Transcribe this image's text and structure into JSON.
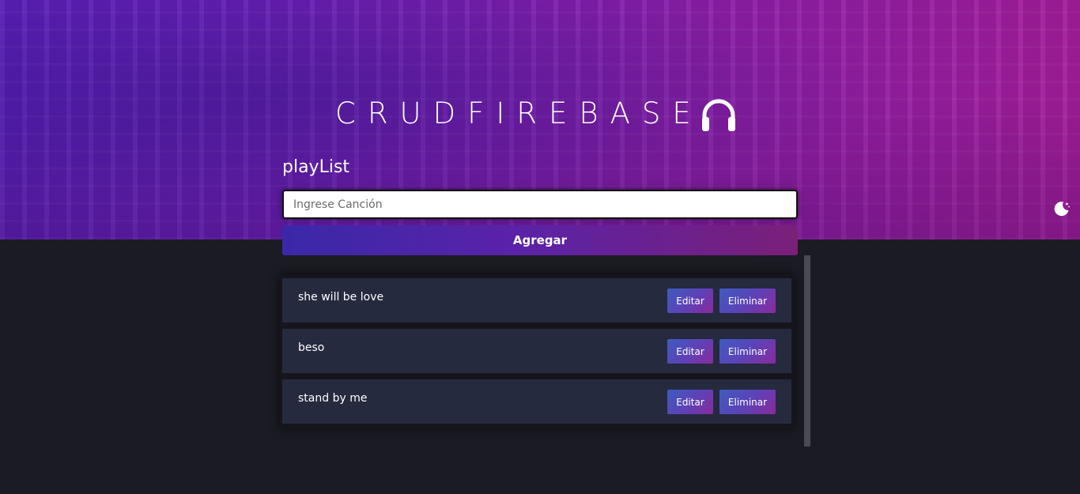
{
  "header": {
    "logo_text": "CRUDFIREBASE",
    "logo_icon": "headphones-icon"
  },
  "playlist": {
    "title": "playList",
    "input_placeholder": "Ingrese Canción",
    "input_value": "",
    "add_label": "Agregar"
  },
  "theme_toggle": {
    "icon": "moon-icon"
  },
  "songs": [
    {
      "name": "she will be love",
      "edit_label": "Editar",
      "delete_label": "Eliminar"
    },
    {
      "name": "beso",
      "edit_label": "Editar",
      "delete_label": "Eliminar"
    },
    {
      "name": "stand by me",
      "edit_label": "Editar",
      "delete_label": "Eliminar"
    }
  ],
  "colors": {
    "page_background": "#1b1b24",
    "hero_start": "#5a1fb8",
    "hero_end": "#a21d9a",
    "item_background": "#252a3f",
    "button_gradient_start": "#3d5cbf",
    "button_gradient_end": "#8a2a9c"
  }
}
